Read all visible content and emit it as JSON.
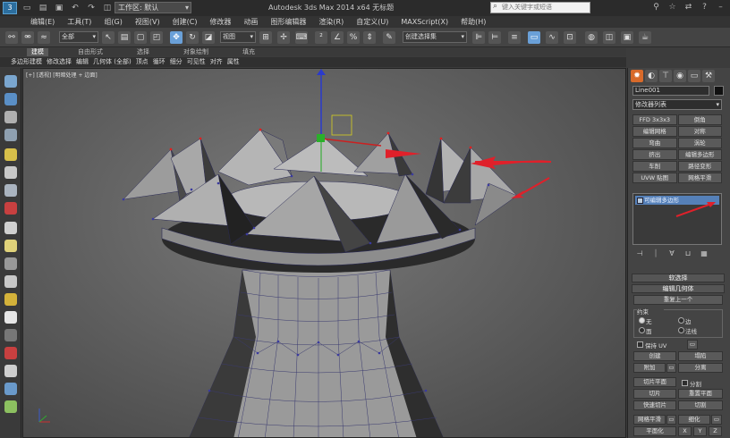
{
  "titlebar": {
    "app_icon": "3ds-max-logo-icon",
    "workspace_label": "工作区: 默认",
    "app_title": "Autodesk 3ds Max  2014 x64      无标题",
    "search_placeholder": "键入关键字或短语"
  },
  "menubar": {
    "items": [
      "编辑(E)",
      "工具(T)",
      "组(G)",
      "视图(V)",
      "创建(C)",
      "修改器",
      "动画",
      "图形编辑器",
      "渲染(R)",
      "自定义(U)",
      "MAXScript(X)",
      "帮助(H)"
    ]
  },
  "toolbar": {
    "filter_select": "全部",
    "coord_select": "视图",
    "selection_set": "创建选择集"
  },
  "ribbon": {
    "tabs": [
      "建模",
      "自由形式",
      "选择",
      "对象绘制",
      "填充"
    ],
    "active_tab": "建模",
    "sub_items": [
      "多边形建模",
      "修改选择",
      "编辑",
      "几何体 (全部)",
      "顶点",
      "循环",
      "细分",
      "可见性",
      "对齐",
      "属性"
    ]
  },
  "viewport": {
    "label": "[+] [透视] [明暗处理 + 边面]"
  },
  "command_panel": {
    "object_name": "Line001",
    "modifier_list": "修改器列表",
    "modifier_buttons": [
      "FFD 3x3x3",
      "倒角",
      "编辑网格",
      "对称",
      "弯曲",
      "涡轮",
      "挤出",
      "编辑多边形",
      "车削",
      "路径变形",
      "UVW 贴图",
      "网格平滑"
    ],
    "stack_item": "可编辑多边形",
    "soft_selection": "软选择",
    "edit_geometry": "编辑几何体",
    "repeat_last": "重复上一个",
    "constraints_label": "约束",
    "constraint_none": "无",
    "constraint_edge": "边",
    "constraint_face": "面",
    "constraint_normal": "法线",
    "preserve_uv": "保持 UV",
    "create": "创建",
    "collapse": "塌陷",
    "attach": "附加",
    "detach": "分离",
    "slice_plane": "切片平面",
    "split": "分割",
    "slice": "切片",
    "reset_plane": "重置平面",
    "quickslice": "快速切片",
    "cut": "切割",
    "meshsmooth": "网格平滑",
    "tessellate": "细化",
    "planarize": "平面化",
    "x": "X",
    "y": "Y",
    "z": "Z"
  },
  "colors": {
    "accent_orange": "#d86a2a",
    "selection_blue": "#5580b8",
    "annotation_red": "#e0202a"
  }
}
